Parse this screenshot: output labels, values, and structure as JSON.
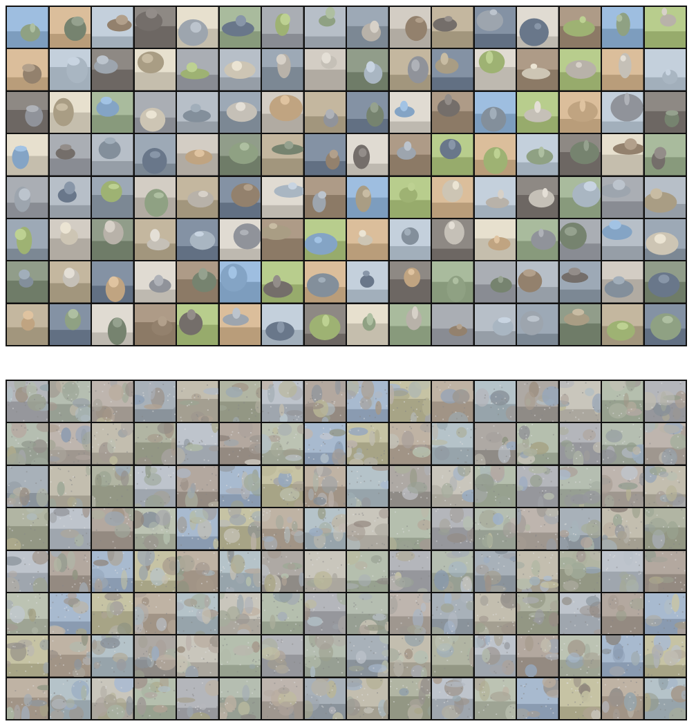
{
  "figure": {
    "panels": [
      {
        "name": "top-grid",
        "rows": 8,
        "cols": 16,
        "style": "sharp",
        "palette": [
          "#8b8f96",
          "#9aa3ad",
          "#7c8a98",
          "#b9b2a8",
          "#6e7c66",
          "#a89a7e",
          "#5f6f84",
          "#c8c2b8",
          "#8f7a63",
          "#7da2c8",
          "#9bb26a",
          "#c2a27a",
          "#a8b6c4",
          "#6b6560",
          "#d0c8b4",
          "#8a9e7c"
        ]
      },
      {
        "name": "bottom-grid",
        "rows": 8,
        "cols": 16,
        "style": "noisy",
        "palette": [
          "#8e9096",
          "#8f9a8a",
          "#9a8f86",
          "#7f8a94",
          "#a09a88",
          "#8a8f78",
          "#9aa2ac",
          "#8c7f74",
          "#98a08c",
          "#7f95b0",
          "#a4a07a",
          "#9c8c7a",
          "#8fa0a8",
          "#86807a",
          "#a8a498",
          "#8f9c86"
        ]
      }
    ]
  }
}
